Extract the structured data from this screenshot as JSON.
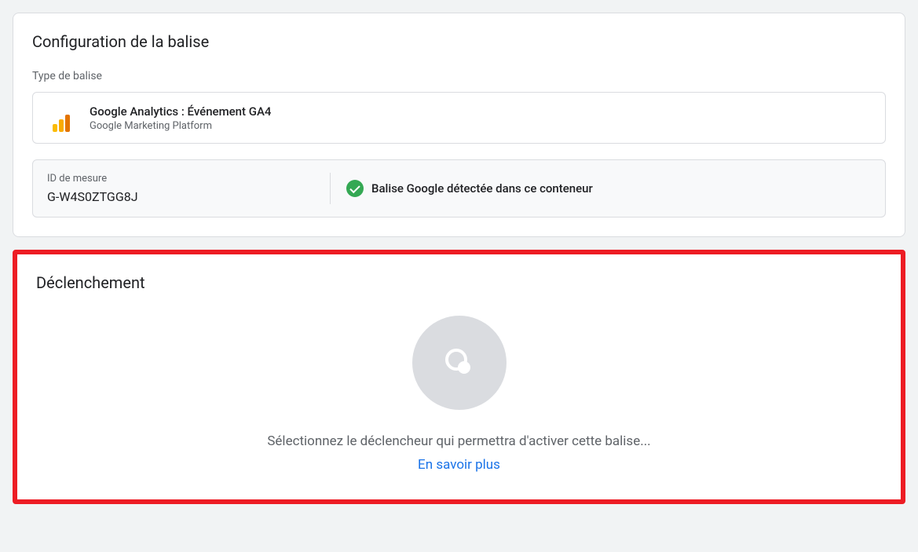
{
  "config": {
    "title": "Configuration de la balise",
    "tagTypeLabel": "Type de balise",
    "tagType": {
      "name": "Google Analytics : Événement GA4",
      "platform": "Google Marketing Platform"
    },
    "measurement": {
      "label": "ID de mesure",
      "value": "G-W4S0ZTGG8J",
      "statusText": "Balise Google détectée dans ce conteneur"
    }
  },
  "trigger": {
    "title": "Déclenchement",
    "emptyText": "Sélectionnez le déclencheur qui permettra d'activer cette balise...",
    "learnMore": "En savoir plus"
  }
}
